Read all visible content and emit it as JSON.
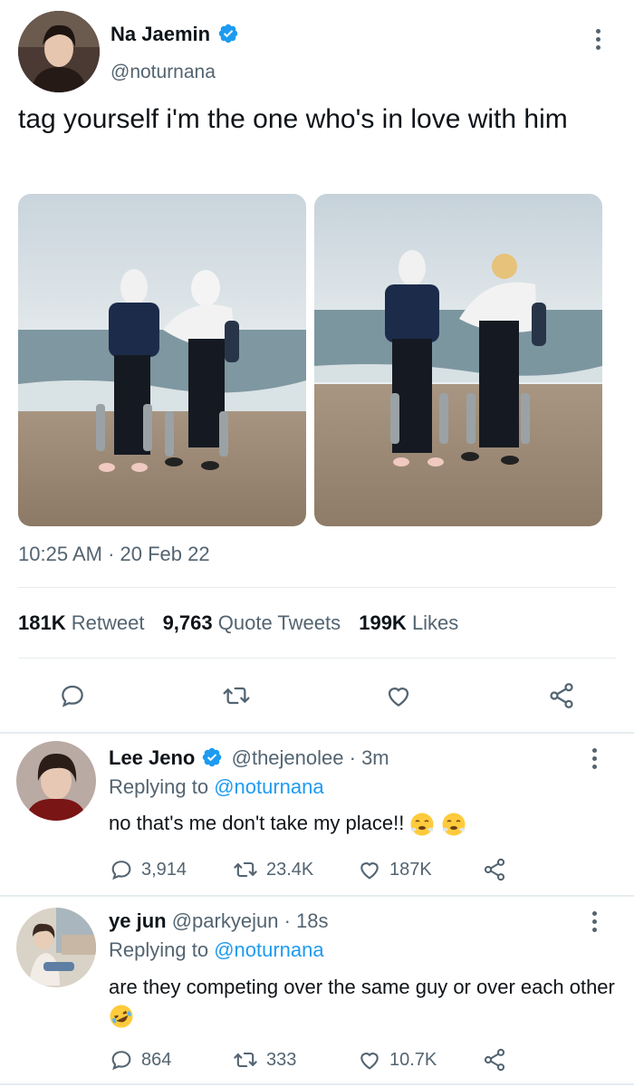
{
  "tweet": {
    "author_name": "Na Jaemin",
    "author_handle": "@noturnana",
    "text": "tag yourself i'm the one who's in love with him",
    "timestamp": "10:25 AM · 20 Feb 22",
    "stats": {
      "retweets_count": "181K",
      "retweets_label": "Retweet",
      "quotes_count": "9,763",
      "quotes_label": "Quote Tweets",
      "likes_count": "199K",
      "likes_label": "Likes"
    },
    "icons": [
      "reply-icon",
      "retweet-icon",
      "like-icon",
      "share-icon"
    ]
  },
  "replies": [
    {
      "author_name": "Lee Jeno",
      "author_handle": "@thejenolee",
      "time": "· 3m",
      "replying_prefix": "Replying to",
      "replying_handle": "@noturnana",
      "text": "no that's me don't take my place!!",
      "reply_count": "3,914",
      "retweet_count": "23.4K",
      "like_count": "187K"
    },
    {
      "author_name": "ye jun",
      "author_handle": "@parkyejun",
      "time": "· 18s",
      "replying_prefix": "Replying to",
      "replying_handle": "@noturnana",
      "text": "are they competing over the same guy or over each other",
      "reply_count": "864",
      "retweet_count": "333",
      "like_count": "10.7K"
    }
  ],
  "colors": {
    "accent": "#1d9bf0",
    "muted": "#536471",
    "text": "#0f1419",
    "divider": "#e6ecf0"
  }
}
